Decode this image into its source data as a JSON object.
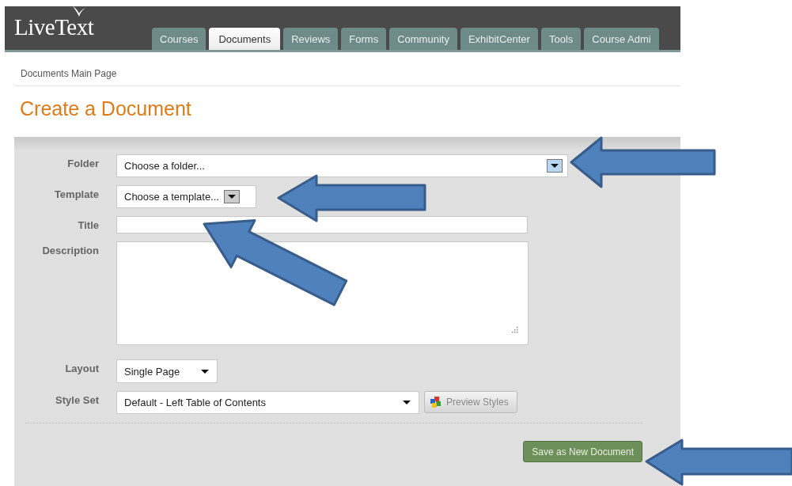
{
  "logo": "LiveText",
  "tabs": [
    {
      "label": "Courses",
      "selected": false
    },
    {
      "label": "Documents",
      "selected": true
    },
    {
      "label": "Reviews",
      "selected": false
    },
    {
      "label": "Forms",
      "selected": false
    },
    {
      "label": "Community",
      "selected": false
    },
    {
      "label": "ExhibitCenter",
      "selected": false
    },
    {
      "label": "Tools",
      "selected": false
    },
    {
      "label": "Course Admi",
      "selected": false
    }
  ],
  "breadcrumb": "Documents Main Page",
  "heading": "Create a Document",
  "form": {
    "fields": [
      {
        "label": "Folder",
        "kind": "dropdown",
        "value": "Choose a folder..."
      },
      {
        "label": "Template",
        "kind": "combo",
        "value": "Choose a template..."
      },
      {
        "label": "Title",
        "kind": "text"
      },
      {
        "label": "Description",
        "kind": "textarea"
      },
      {
        "label": "Layout",
        "kind": "select",
        "value": "Single Page"
      },
      {
        "label": "Style Set",
        "kind": "select",
        "value": "Default - Left Table of Contents",
        "button": "Preview Styles"
      }
    ],
    "submit": "Save as New Document"
  }
}
